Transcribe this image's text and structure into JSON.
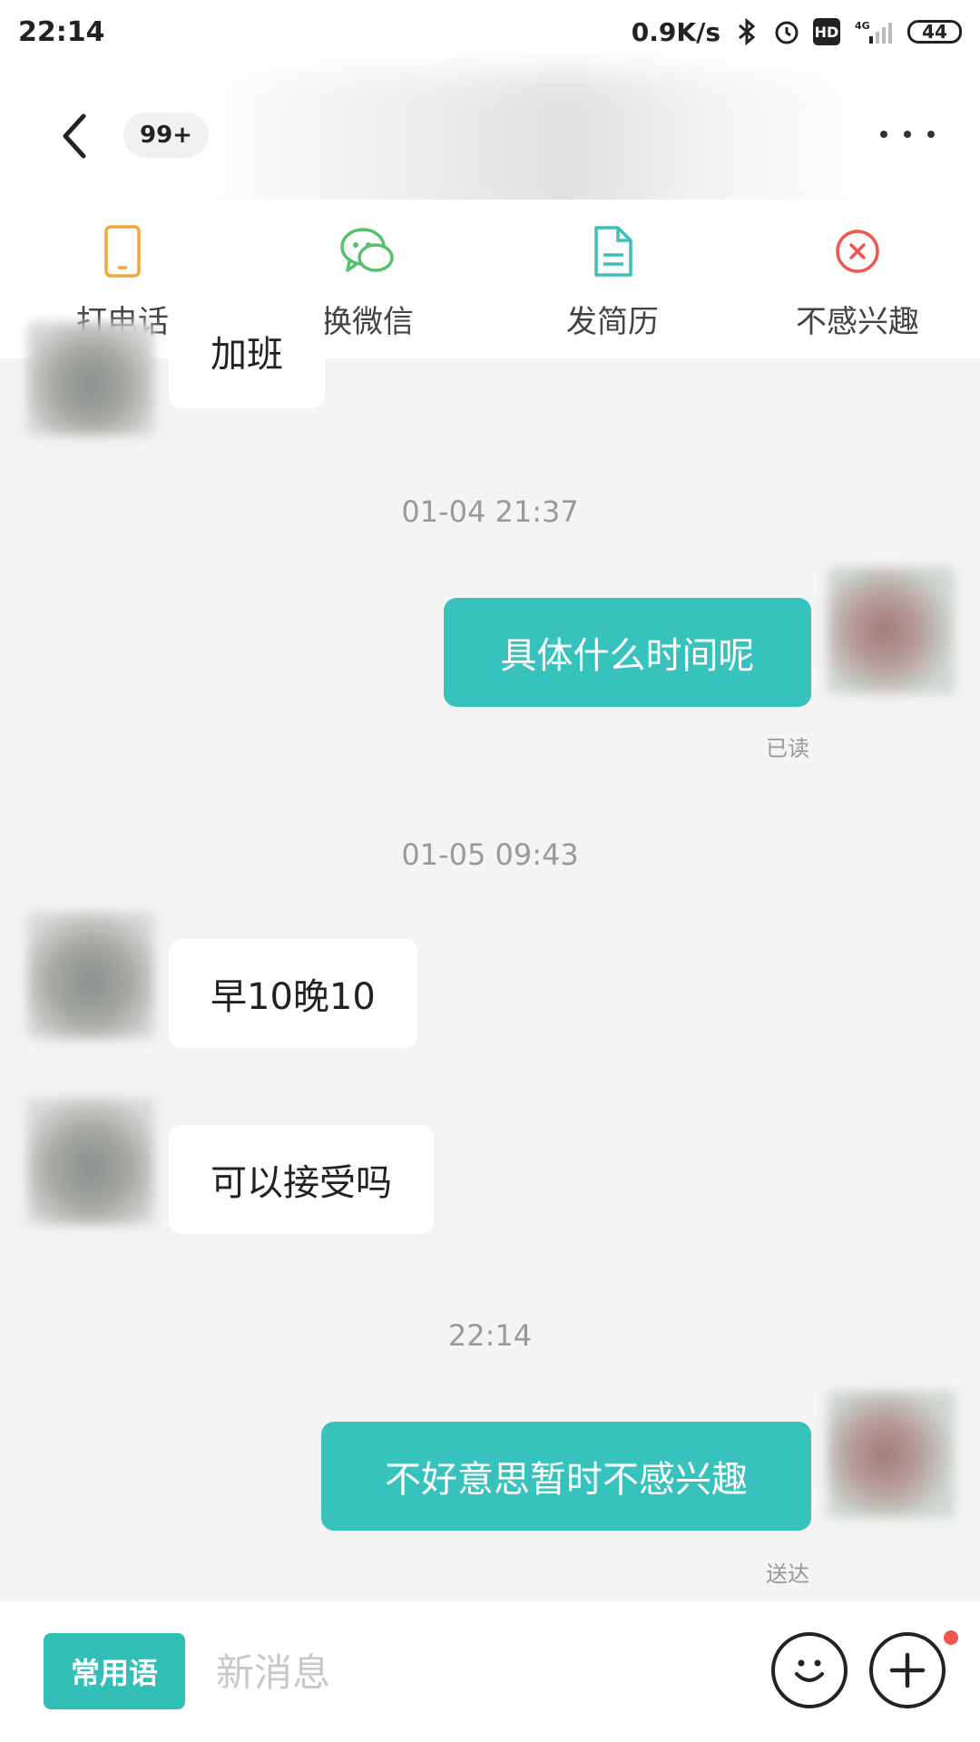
{
  "status_bar": {
    "time": "22:14",
    "speed": "0.9K/s",
    "hd": "HD",
    "net": "4G",
    "battery": "44"
  },
  "header": {
    "unread_badge": "99+"
  },
  "actions": [
    {
      "label": "打电话",
      "icon": "phone-icon",
      "color": "#f1a93c"
    },
    {
      "label": "换微信",
      "icon": "wechat-icon",
      "color": "#56c06b"
    },
    {
      "label": "发简历",
      "icon": "document-icon",
      "color": "#3cbfb7"
    },
    {
      "label": "不感兴趣",
      "icon": "close-circle-icon",
      "color": "#f0554f"
    }
  ],
  "messages": {
    "partial_incoming": "加班",
    "ts1": "01-04 21:37",
    "out1": "具体什么时间呢",
    "out1_status": "已读",
    "ts2": "01-05 09:43",
    "in1": "早10晚10",
    "in2": "可以接受吗",
    "ts3": "22:14",
    "out2": "不好意思暂时不感兴趣",
    "out2_status": "送达"
  },
  "bottom": {
    "quick_phrases": "常用语",
    "input_placeholder": "新消息"
  },
  "colors": {
    "accent": "#37c2bd",
    "background": "#f4f4f4"
  }
}
